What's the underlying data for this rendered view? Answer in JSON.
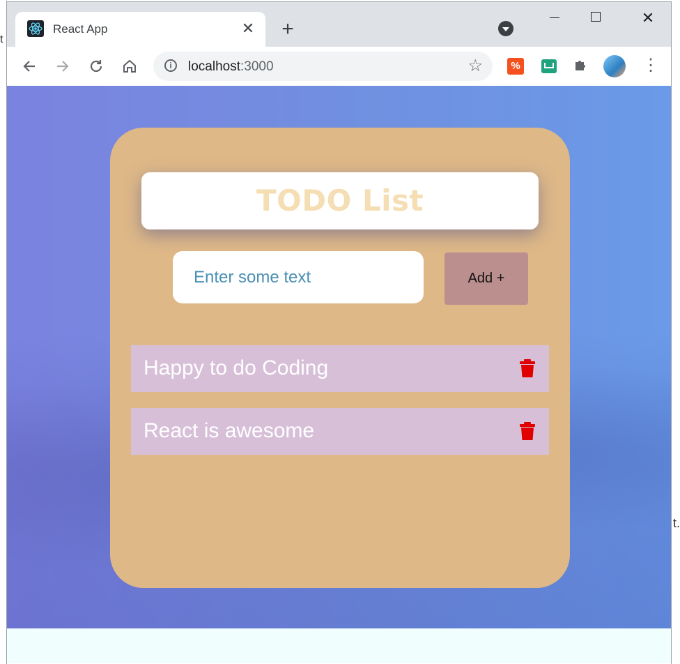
{
  "browser": {
    "tab_title": "React App",
    "tab_close": "✕",
    "new_tab": "+",
    "url_host": "localhost",
    "url_port": ":3000",
    "ext_icon_1": "%",
    "icons": [
      "react-favicon",
      "tab-search-icon",
      "back-arrow-icon",
      "forward-arrow-icon",
      "reload-icon",
      "home-icon",
      "info-icon",
      "star-icon",
      "extension-icon",
      "puzzle-icon",
      "avatar",
      "kebab-menu-icon"
    ]
  },
  "background_glyphs": {
    "left": "t",
    "right": "t."
  },
  "app": {
    "title": "TODO List",
    "input_placeholder": "Enter some text",
    "input_value": "",
    "add_button": "Add +",
    "items": [
      {
        "text": "Happy to do Coding"
      },
      {
        "text": "React is awesome"
      }
    ]
  },
  "colors": {
    "card": "#deb887",
    "title_text": "#f5deb3",
    "add_button": "#bc8f8f",
    "item_bg": "#d8bfd8",
    "trash": "#e00000",
    "bg_gradient": [
      "#7b83e0",
      "#6a9ae8"
    ]
  }
}
